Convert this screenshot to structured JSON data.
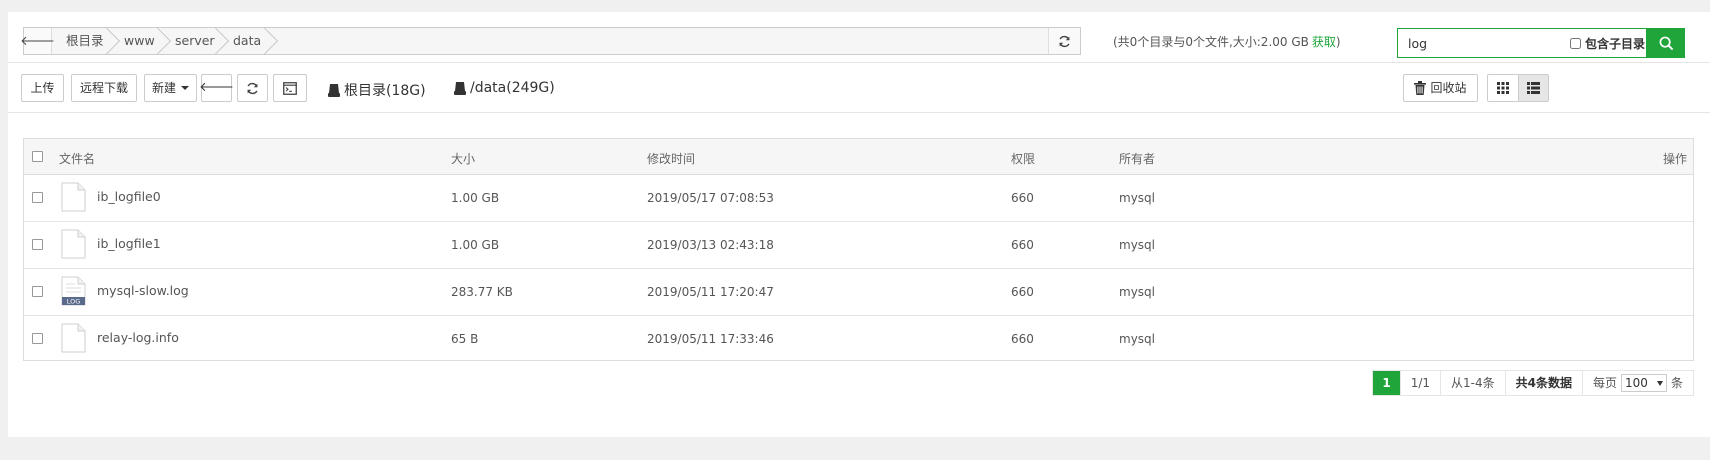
{
  "breadcrumb": {
    "items": [
      "根目录",
      "www",
      "server",
      "data"
    ]
  },
  "summary": {
    "text": "(共0个目录与0个文件,大小:2.00 GB",
    "fetch_label": "获取",
    "close_paren": ")"
  },
  "search": {
    "value": "log",
    "include_subdir_label": "包含子目录"
  },
  "toolbar": {
    "upload": "上传",
    "remote_download": "远程下载",
    "new": "新建",
    "disks": [
      {
        "label": "根目录(18G)"
      },
      {
        "label": "/data(249G)"
      }
    ],
    "recycle_bin": "回收站"
  },
  "table": {
    "headers": {
      "name": "文件名",
      "size": "大小",
      "mtime": "修改时间",
      "perm": "权限",
      "owner": "所有者",
      "actions": "操作"
    },
    "rows": [
      {
        "name": "ib_logfile0",
        "size": "1.00 GB",
        "mtime": "2019/05/17 07:08:53",
        "perm": "660",
        "owner": "mysql",
        "icon": "blank-file-icon"
      },
      {
        "name": "ib_logfile1",
        "size": "1.00 GB",
        "mtime": "2019/03/13 02:43:18",
        "perm": "660",
        "owner": "mysql",
        "icon": "blank-file-icon"
      },
      {
        "name": "mysql-slow.log",
        "size": "283.77 KB",
        "mtime": "2019/05/11 17:20:47",
        "perm": "660",
        "owner": "mysql",
        "icon": "log-file-icon",
        "icon_badge": "LOG"
      },
      {
        "name": "relay-log.info",
        "size": "65 B",
        "mtime": "2019/05/11 17:33:46",
        "perm": "660",
        "owner": "mysql",
        "icon": "blank-file-icon"
      }
    ]
  },
  "pagination": {
    "current": "1",
    "pages": "1/1",
    "range": "从1-4条",
    "total": "共4条数据",
    "per_page_label": "每页",
    "per_page_value": "100",
    "unit": "条"
  },
  "colors": {
    "accent": "#20a53a"
  }
}
